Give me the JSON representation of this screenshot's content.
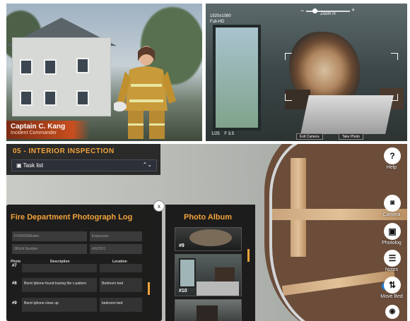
{
  "top_left": {
    "caption_name": "Captain C. Kang",
    "caption_role": "Incident Commander"
  },
  "top_right": {
    "resolution": "1920x1080",
    "quality": "Full-HD",
    "zoom_label": "Zoom in",
    "zoom_minus": "−",
    "zoom_plus": "+",
    "zoom_level": 0.2,
    "frame_counter": "1/25",
    "fstop": "F 3.5",
    "exit_camera_label": "Exit Camera",
    "take_photo_label": "Take Photo"
  },
  "main": {
    "section_title": "05 - INTERIOR INSPECTION",
    "task_list_label": "Task list",
    "right_toolbar": [
      {
        "icon": "help-icon",
        "glyph": "?",
        "label": "Help"
      },
      {
        "icon": "camera-icon",
        "glyph": "📷",
        "label": "Camera"
      },
      {
        "icon": "photolog-icon",
        "glyph": "▣",
        "label": "Photolog"
      },
      {
        "icon": "notes-icon",
        "glyph": "☰",
        "label": "Notes"
      },
      {
        "icon": "move-bed-icon",
        "glyph": "⇅",
        "label": "Move Bed"
      },
      {
        "icon": "eye-icon",
        "glyph": "◉",
        "label": ""
      }
    ],
    "move_bed_toggle_on": true
  },
  "photo_log": {
    "title": "Fire Department Photograph Log",
    "fields": [
      {
        "value": "F#20#3006utter"
      },
      {
        "value": "Exposures"
      },
      {
        "value": "06Unit Number"
      },
      {
        "value": "4/6/2021"
      }
    ],
    "headers": {
      "photo": "Photo",
      "description": "Description",
      "location": "Location"
    },
    "rows": [
      {
        "num": "#7",
        "description": "",
        "location": ""
      },
      {
        "num": "#8",
        "description": "Burnt Iphone found tracing the v pattern",
        "location": "Bedroom bed"
      },
      {
        "num": "#9",
        "description": "Burnt Iphone close up",
        "location": "bedroom bed"
      }
    ],
    "close_label": "x"
  },
  "photo_album": {
    "title": "Photo Album",
    "photos": [
      {
        "num": "#9"
      },
      {
        "num": "#10"
      },
      {
        "num": ""
      }
    ]
  }
}
